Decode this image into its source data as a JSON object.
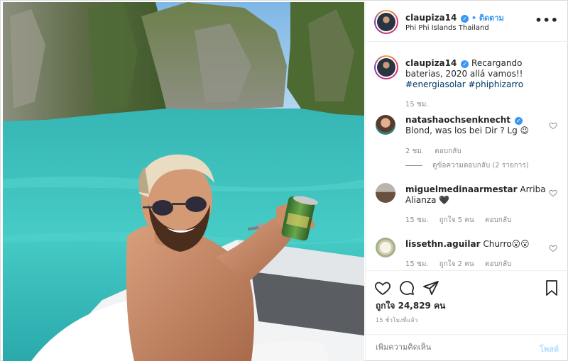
{
  "post": {
    "username": "claupiza14",
    "follow_label": "ติดตาม",
    "location": "Phi Phi Islands Thailand",
    "more_label": "•••"
  },
  "caption": {
    "username": "claupiza14",
    "text": "Recargando baterias, 2020 allá vamos!!",
    "hashtags": [
      "#energiasolar",
      "#phiphizarro"
    ],
    "time": "15 ชม."
  },
  "comments": [
    {
      "username": "natashaochsenknecht",
      "verified": true,
      "text": "Blond, was los bei Dir ? Lg 😉",
      "time": "2 ชม.",
      "likes": "",
      "reply_label": "ตอบกลับ",
      "replies_label": "ดูข้อความตอบกลับ (2 รายการ)"
    },
    {
      "username": "miguelmedinaarmestar",
      "verified": false,
      "text": "Arriba Alianza 🖤",
      "time": "15 ชม.",
      "likes": "ถูกใจ 5 คน",
      "reply_label": "ตอบกลับ"
    },
    {
      "username": "lissethn.aguilar",
      "verified": false,
      "text": "Churro😮😮",
      "time": "15 ชม.",
      "likes": "ถูกใจ 2 คน",
      "reply_label": "ตอบกลับ"
    }
  ],
  "actions": {
    "likes_text": "ถูกใจ 24,829 คน",
    "posted_time": "15 ชั่วโมงที่แล้ว"
  },
  "add_comment": {
    "placeholder": "เพิ่มความคิดเห็น",
    "post_label": "โพสต์"
  },
  "colors": {
    "accent": "#3897f0",
    "muted": "#8e8e8e",
    "hashtag": "#003569",
    "sea": "#3cc7c4"
  },
  "icons": {
    "like": "heart-icon",
    "comment": "comment-bubble-icon",
    "share": "paper-plane-icon",
    "save": "bookmark-icon",
    "more": "more-dots-icon"
  }
}
